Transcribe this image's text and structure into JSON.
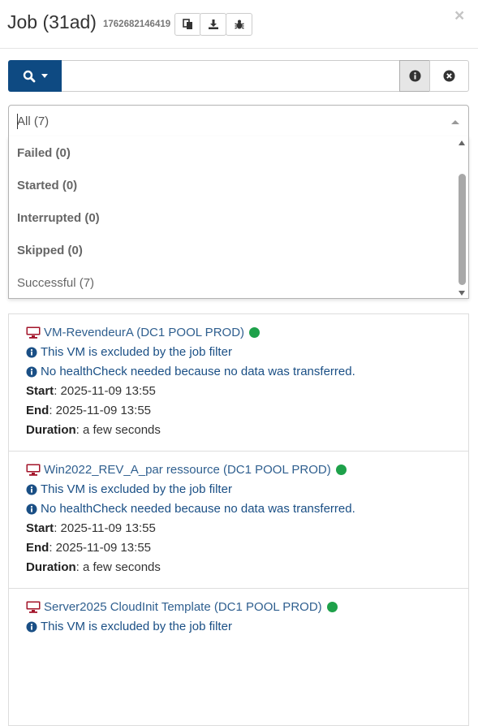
{
  "header": {
    "title": "Job (31ad)",
    "job_id": "1762682146419",
    "icons": [
      "copy-icon",
      "download-icon",
      "bug-icon"
    ],
    "close_label": "×"
  },
  "search": {
    "button_icon": "search-icon",
    "value": "",
    "placeholder": ""
  },
  "filter": {
    "selected": "All (7)",
    "options": [
      {
        "label": "Failed (0)",
        "emphasis": true
      },
      {
        "label": "Started (0)",
        "emphasis": true
      },
      {
        "label": "Interrupted (0)",
        "emphasis": true
      },
      {
        "label": "Skipped (0)",
        "emphasis": true
      },
      {
        "label": "Successful (7)",
        "emphasis": false
      }
    ]
  },
  "colors": {
    "primary": "#0e4a82",
    "link": "#2f5f8f",
    "info": "#1a4f85",
    "vm_icon": "#a3142a",
    "status_ok": "#1ea14a"
  },
  "details_labels": {
    "start": "Start",
    "end": "End",
    "duration": "Duration"
  },
  "vms": [
    {
      "name": "VM-RevendeurA (DC1 POOL PROD)",
      "status": "success",
      "messages": [
        "This VM is excluded by the job filter",
        "No healthCheck needed because no data was transferred."
      ],
      "start": ": 2025-11-09 13:55",
      "end": ": 2025-11-09 13:55",
      "duration": ": a few seconds"
    },
    {
      "name": "Win2022_REV_A_par ressource (DC1 POOL PROD)",
      "status": "success",
      "messages": [
        "This VM is excluded by the job filter",
        "No healthCheck needed because no data was transferred."
      ],
      "start": ": 2025-11-09 13:55",
      "end": ": 2025-11-09 13:55",
      "duration": ": a few seconds"
    },
    {
      "name": "Server2025 CloudInit Template (DC1 POOL PROD)",
      "status": "success",
      "messages": [
        "This VM is excluded by the job filter"
      ]
    }
  ]
}
